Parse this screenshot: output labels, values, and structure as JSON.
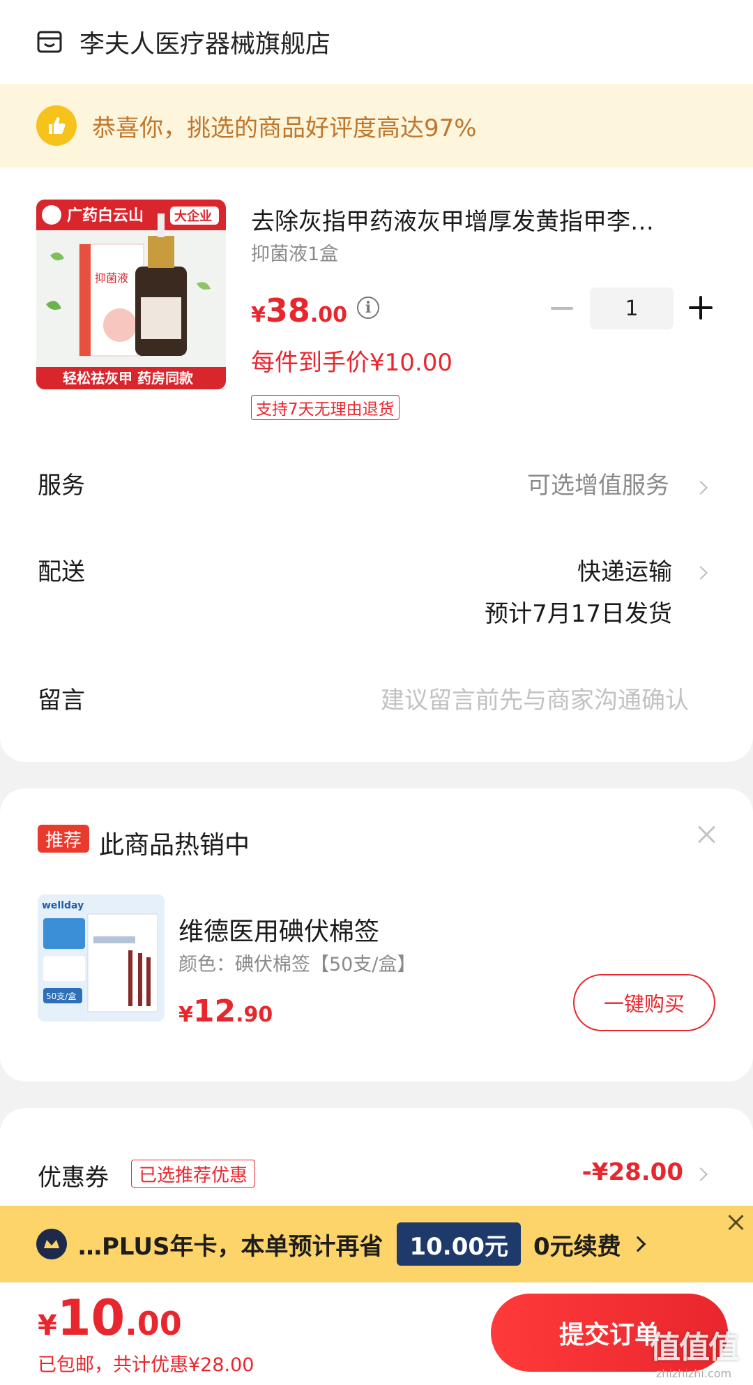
{
  "store": {
    "name": "李夫人医疗器械旗舰店"
  },
  "praise": {
    "text": "恭喜你，挑选的商品好评度高达97%"
  },
  "product": {
    "image_brand": "广药白云山",
    "image_badge": "大企业",
    "image_caption": "轻松祛灰甲 药房同款",
    "image_box_text": "抑菌液",
    "title": "去除灰指甲药液灰甲增厚发黄指甲李…",
    "spec": "抑菌液1盒",
    "price_yen": "¥",
    "price_int": "38",
    "price_dec": ".00",
    "quantity": "1",
    "per_unit": "每件到手价¥10.00",
    "return_tag": "支持7天无理由退货"
  },
  "rows": {
    "service_label": "服务",
    "service_value": "可选增值服务",
    "delivery_label": "配送",
    "delivery_value": "快递运输",
    "delivery_eta": "预计7月17日发货",
    "message_label": "留言",
    "message_placeholder": "建议留言前先与商家沟通确认"
  },
  "recommend": {
    "tag": "推荐",
    "title": "此商品热销中",
    "image_brand": "wellday",
    "image_tag": "50支/盒",
    "name": "维德医用碘伏棉签",
    "spec": "颜色：碘伏棉签【50支/盒】",
    "price_yen": "¥",
    "price_int": "12",
    "price_dec": ".90",
    "buy_label": "一键购买"
  },
  "coupon": {
    "label": "优惠券",
    "tag": "已选推荐优惠",
    "value": "-¥28.00"
  },
  "plus": {
    "text": "…PLUS年卡，本单预计再省",
    "save": "10.00元",
    "renew": "0元续费"
  },
  "footer": {
    "total_yen": "¥",
    "total_int": "10",
    "total_dec": ".00",
    "sub": "已包邮，共计优惠¥28.00",
    "submit": "提交订单"
  },
  "watermark": {
    "big": "值值值",
    "small": "zhizhizhi.com"
  },
  "colors": {
    "accent": "#e8262d",
    "praise_bg": "#fdf5dc",
    "plus_bg": "#fcd46a"
  }
}
